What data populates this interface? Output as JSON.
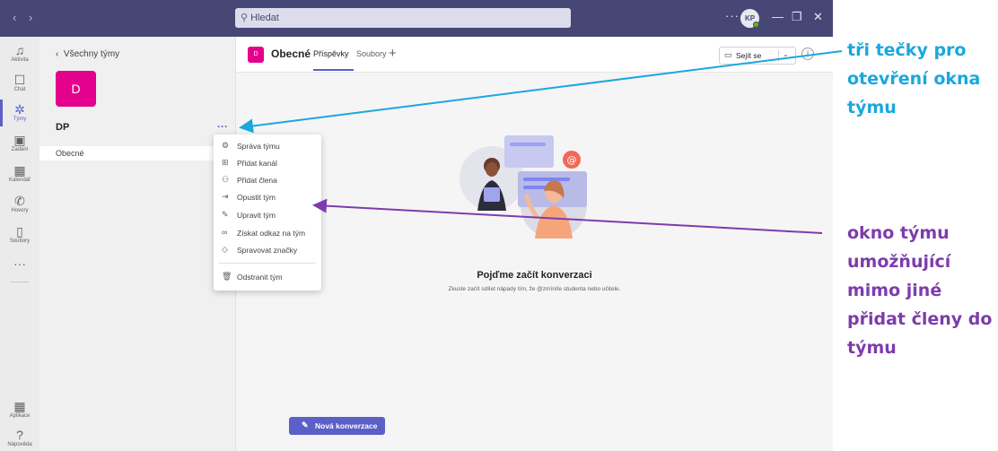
{
  "titlebar": {
    "back_glyph": "‹",
    "forward_glyph": "›",
    "search_placeholder": "Hledat",
    "more_glyph": "···",
    "avatar_initials": "KP",
    "minimize_glyph": "—",
    "maximize_glyph": "❐",
    "close_glyph": "✕"
  },
  "rail": {
    "items": [
      {
        "label": "Aktivita",
        "icon": "bell-icon",
        "glyph": "♫"
      },
      {
        "label": "Chat",
        "icon": "chat-icon",
        "glyph": "☐"
      },
      {
        "label": "Týmy",
        "icon": "teams-icon",
        "glyph": "✲"
      },
      {
        "label": "Zadání",
        "icon": "assignments-icon",
        "glyph": "▣"
      },
      {
        "label": "Kalendář",
        "icon": "calendar-icon",
        "glyph": "▦"
      },
      {
        "label": "Hovory",
        "icon": "phone-icon",
        "glyph": "✆"
      },
      {
        "label": "Soubory",
        "icon": "files-icon",
        "glyph": "▯"
      }
    ],
    "more_glyph": "···",
    "apps_label": "Aplikace",
    "help_label": "Nápověda",
    "active": "Týmy"
  },
  "teampane": {
    "back_label": "Všechny týmy",
    "team_initial": "D",
    "team_name": "DP",
    "more_glyph": "···",
    "channel": "Obecné"
  },
  "menu": {
    "items": [
      {
        "label": "Správa týmu",
        "icon": "gear-icon",
        "glyph": "⚙"
      },
      {
        "label": "Přidat kanál",
        "icon": "add-channel-icon",
        "glyph": "⊞"
      },
      {
        "label": "Přidat člena",
        "icon": "add-member-icon",
        "glyph": "⚇"
      },
      {
        "label": "Opustit tým",
        "icon": "leave-icon",
        "glyph": "⇥"
      },
      {
        "label": "Upravit tým",
        "icon": "pencil-icon",
        "glyph": "✎"
      },
      {
        "label": "Získat odkaz na tým",
        "icon": "link-icon",
        "glyph": "∞"
      },
      {
        "label": "Spravovat značky",
        "icon": "tag-icon",
        "glyph": "◇"
      },
      {
        "label": "Odstranit tým",
        "icon": "trash-icon",
        "glyph": "🗑"
      }
    ]
  },
  "channel": {
    "icon_initial": "D",
    "title": "Obecné",
    "tabs": [
      "Příspěvky",
      "Soubory"
    ],
    "add_tab_glyph": "+",
    "meet_label": "Sejít se",
    "info_glyph": "i"
  },
  "empty_state": {
    "title": "Pojďme začít konverzaci",
    "subtitle": "Zkuste začít sdílet nápady tím, že @zmíníte studenta nebo učitele."
  },
  "new_conversation_label": "Nová konverzace",
  "annotations": {
    "blue": "tři tečky pro otevření okna týmu",
    "purple": "okno týmu umožňující mimo jiné přidat členy do týmu"
  },
  "colors": {
    "titlebar": "#464775",
    "accent": "#5b5fc7",
    "team_tile": "#e3008c",
    "annotation_blue": "#1aa7df",
    "annotation_purple": "#7d3cad"
  }
}
